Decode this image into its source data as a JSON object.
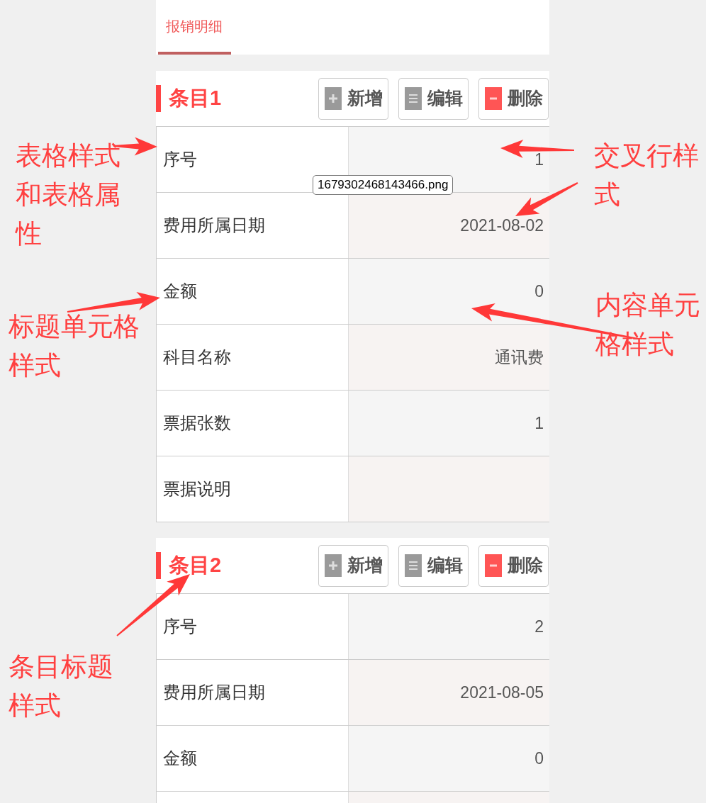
{
  "tabs": [
    {
      "label": "报销明细",
      "selected": true
    }
  ],
  "items": [
    {
      "title": "条目1",
      "buttons": [
        {
          "kind": "add",
          "label": "新增"
        },
        {
          "kind": "edit",
          "label": "编辑"
        },
        {
          "kind": "delete",
          "label": "删除"
        }
      ],
      "rows": [
        {
          "label": "序号",
          "value": "1"
        },
        {
          "label": "费用所属日期",
          "value": "2021-08-02"
        },
        {
          "label": "金额",
          "value": "0"
        },
        {
          "label": "科目名称",
          "value": "通讯费"
        },
        {
          "label": "票据张数",
          "value": "1"
        },
        {
          "label": "票据说明"
        }
      ]
    },
    {
      "title": "条目2",
      "buttons": [
        {
          "kind": "add",
          "label": "新增"
        },
        {
          "kind": "edit",
          "label": "编辑"
        },
        {
          "kind": "delete",
          "label": "删除"
        }
      ],
      "rows": [
        {
          "label": "序号",
          "value": "2"
        },
        {
          "label": "费用所属日期",
          "value": "2021-08-05"
        },
        {
          "label": "金额",
          "value": "0"
        },
        {}
      ]
    }
  ],
  "tooltip": "1679302468143466.png",
  "annotations": [
    "表格样式和表格属性",
    "交叉行样式",
    "内容单元格样式",
    "标题单元格样式",
    "条目标题样式"
  ]
}
